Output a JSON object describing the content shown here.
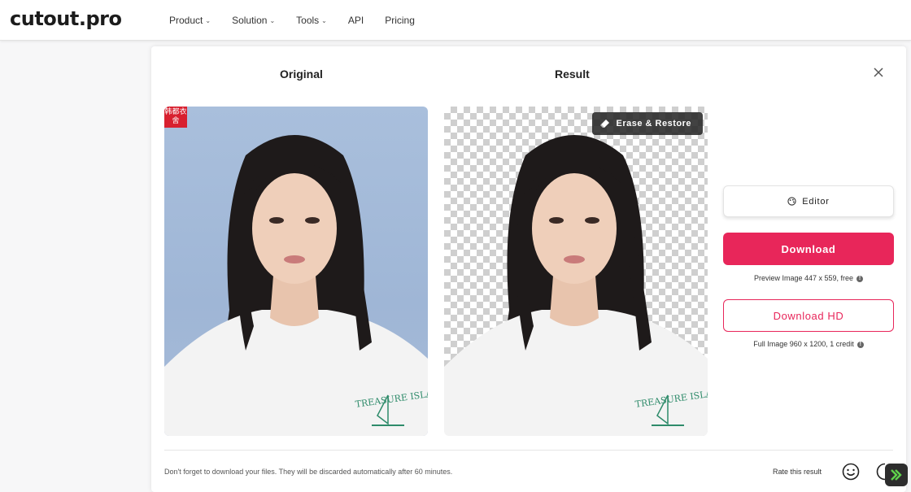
{
  "brand": {
    "logo_text": "cutout.pro"
  },
  "nav": {
    "items": [
      {
        "label": "Product",
        "has_dropdown": true
      },
      {
        "label": "Solution",
        "has_dropdown": true
      },
      {
        "label": "Tools",
        "has_dropdown": true
      },
      {
        "label": "API",
        "has_dropdown": false
      },
      {
        "label": "Pricing",
        "has_dropdown": false
      }
    ]
  },
  "panel": {
    "original_title": "Original",
    "result_title": "Result",
    "close_icon": "close-icon",
    "stamp_text": "韩都衣舍",
    "erase_restore_label": "Erase & Restore",
    "editor_label": "Editor",
    "download_label": "Download",
    "preview_info": "Preview Image 447 x 559, free",
    "download_hd_label": "Download HD",
    "full_info": "Full Image 960 x 1200, 1 credit",
    "note": "Don't forget to download your files. They will be discarded automatically after 60 minutes.",
    "rate_label": "Rate this result"
  },
  "colors": {
    "accent": "#e8265a",
    "dark_button": "#2d2d2d",
    "original_bg": "#a9bfdc"
  }
}
